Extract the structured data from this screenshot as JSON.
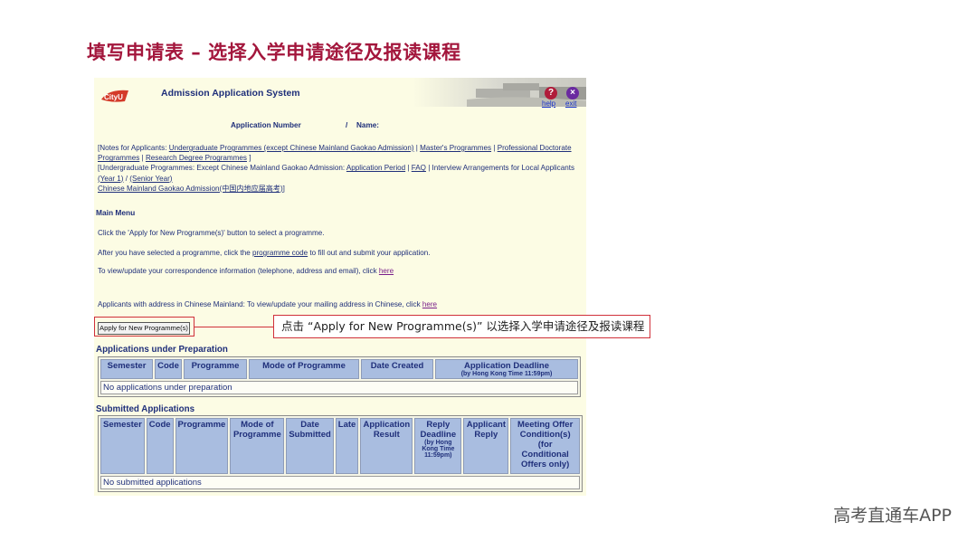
{
  "slide_title": "填写申请表 – 选择入学申请途径及报读课程",
  "watermark": "高考直通车APP",
  "callout_text": "点击 “Apply for New Programme(s)” 以选择入学申请途径及报读课程",
  "header": {
    "logo_text": "CityU",
    "system_title": "Admission Application System",
    "help_label": "help",
    "exit_label": "exit"
  },
  "app_row": {
    "number_label": "Application Number",
    "separator": "/",
    "name_label": "Name:"
  },
  "notes": {
    "open1": "[Notes for Applicants: ",
    "ug_link": "Undergraduate Programmes (except Chinese Mainland Gaokao Admission)",
    "sep": " | ",
    "masters_link": "Master's Programmes",
    "prof_doc_link": "Professional Doctorate Programmes",
    "research_link": "Research Degree Programmes",
    "close": " ]",
    "open2": "[Undergraduate Programmes: Except Chinese Mainland Gaokao Admission: ",
    "period_link": "Application Period",
    "faq_link": "FAQ",
    "interview_text": " | Interview Arrangements for Local Applicants ",
    "year1_link": "(Year 1)",
    "slash": " / ",
    "senior_link": "(Senior Year)",
    "gaokao_link": "Chinese Mainland Gaokao Admission(中国内地应届高考)",
    "close2": "]"
  },
  "main_menu": {
    "heading": "Main Menu",
    "line1": "Click the 'Apply for New Programme(s)' button to select a programme.",
    "line2_pre": "After you have selected a programme, click the ",
    "line2_link": "programme code",
    "line2_post": " to fill out and submit your application.",
    "line3_pre": "To view/update your correspondence information (telephone, address and email), click ",
    "line3_link": "here",
    "line4_pre": "Applicants with address in Chinese Mainland: To view/update your mailing address in Chinese, click ",
    "line4_link": "here",
    "apply_button": "Apply for New Programme(s)"
  },
  "prep_table": {
    "heading": "Applications under Preparation",
    "columns": [
      "Semester",
      "Code",
      "Programme",
      "Mode of Programme",
      "Date Created",
      "Application Deadline"
    ],
    "deadline_note": "(by Hong Kong Time 11:59pm)",
    "empty_text": "No applications under preparation"
  },
  "submitted_table": {
    "heading": "Submitted Applications",
    "columns": [
      "Semester",
      "Code",
      "Programme",
      "Mode of Programme",
      "Date Submitted",
      "Late",
      "Application Result",
      "Reply Deadline",
      "Applicant Reply",
      "Meeting Offer Condition(s) (for Conditional Offers only)"
    ],
    "reply_note": "(by Hong Kong Time 11:59pm)",
    "empty_text": "No submitted applications"
  },
  "colors": {
    "title": "#a3163c",
    "panel_bg": "#fcfce4",
    "header_cell": "#a9bde0",
    "callout_border": "#d0303a",
    "text": "#1f2f7a"
  }
}
